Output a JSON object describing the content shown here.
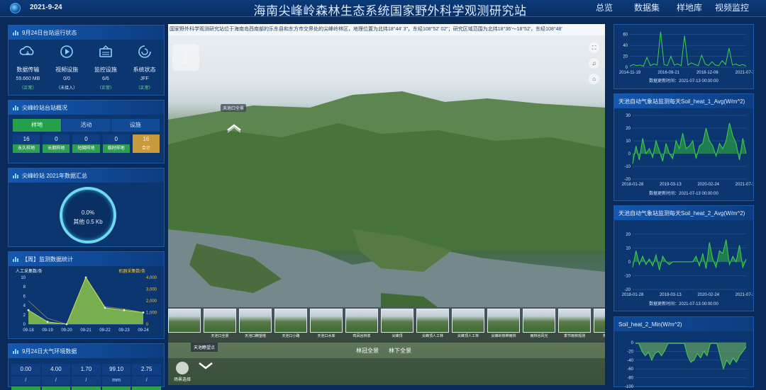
{
  "header": {
    "date": "2021-9-24",
    "title": "海南尖峰岭森林生态系统国家野外科学观测研究站",
    "nav": [
      "总览",
      "数据集",
      "样地库",
      "视频监控"
    ]
  },
  "panel_status": {
    "title": "9月24日台站运行状态",
    "items": [
      {
        "name": "数据传输",
        "value": "59.660 MB",
        "sub": "（正常）",
        "icon": "cloud-icon"
      },
      {
        "name": "视频设施",
        "value": "0/0",
        "sub": "（未接入）",
        "icon": "video-icon"
      },
      {
        "name": "监控设施",
        "value": "6/6",
        "sub": "（正常）",
        "icon": "monitor-icon"
      },
      {
        "name": "系统状态",
        "value": "JFF",
        "sub": "（正常）",
        "icon": "system-icon"
      }
    ]
  },
  "panel_overview": {
    "title": "尖峰岭站台站概况",
    "tabs": [
      "样地",
      "活动",
      "设施"
    ],
    "counts": [
      {
        "num": "16",
        "label": "永久样地"
      },
      {
        "num": "0",
        "label": "长期样地"
      },
      {
        "num": "0",
        "label": "短期样地"
      },
      {
        "num": "0",
        "label": "临时样地"
      },
      {
        "num": "16",
        "label": "合计"
      }
    ]
  },
  "panel_progress": {
    "title": "尖峰岭站 2021年数据汇总",
    "percent": "0.0%",
    "detail": "其他 0.5 Kb"
  },
  "panel_weekly": {
    "title": "【周】监测数据统计",
    "left_label": "人工采集数/条",
    "right_label": "机器采集数/条",
    "chart_data": {
      "type": "area",
      "categories": [
        "09-18",
        "09-19",
        "09-20",
        "09-21",
        "09-22",
        "09-23",
        "09-24"
      ],
      "series": [
        {
          "name": "人工采集数/条",
          "values": [
            3,
            0.5,
            0,
            10,
            3.5,
            3,
            2.5
          ]
        },
        {
          "name": "机器采集数/条",
          "values": [
            2000,
            500,
            0,
            4000,
            1500,
            1300,
            1000
          ]
        }
      ],
      "ylim": [
        0,
        10
      ],
      "y2lim": [
        0,
        4000
      ],
      "yticks": [
        "0",
        "2",
        "4",
        "6",
        "8",
        "10"
      ],
      "y2ticks": [
        "0",
        "1,000",
        "2,000",
        "3,000",
        "4,000"
      ]
    }
  },
  "panel_env": {
    "title": "9月24日大气环境数据",
    "items": [
      {
        "value": "0.00",
        "unit": "/"
      },
      {
        "value": "4.00",
        "unit": "/"
      },
      {
        "value": "1.70",
        "unit": "/"
      },
      {
        "value": "99.10",
        "unit": "mm"
      },
      {
        "value": "2.75",
        "unit": "/"
      }
    ]
  },
  "viewer": {
    "ticker": "国家野外科学观测研究站位于海南岛西南部的乐东县和东方市交界处的尖峰岭林区，地理位置为北纬18°44′ 3″，东经108°52′ 02″；研究区域范围为北纬18°36′～18°52′，东经108°48′",
    "brand": "T",
    "hotspot": "天池口全景",
    "side_buttons": [
      "⛶",
      "♫",
      "⌂"
    ],
    "thumbs": [
      "",
      "天池口全景",
      "天池口瞭望塔",
      "天池口小路",
      "天池口水库",
      "鸣凤谷林浆",
      "尖峰顶",
      "尖峰顶人工林",
      "尖峰顶人工林",
      "尖峰岭热带雨林",
      "雨林谷风光",
      "季节雨林观测",
      "热带雨林"
    ],
    "hover_label": "天池瞭望点",
    "tab_links": [
      "林冠全景",
      "林下全景"
    ],
    "scene_label": "场景选择"
  },
  "right_top": {
    "update": "数据更新时间：2021-07-13 00:00:00",
    "chart_data": {
      "type": "line",
      "xticks": [
        "2014-11-19",
        "2016-09-21",
        "2018-12-06",
        "2021-07-13"
      ],
      "yticks": [
        "0",
        "20",
        "40",
        "60"
      ],
      "ylim": [
        0,
        70
      ],
      "series": [
        {
          "values": [
            2,
            5,
            3,
            4,
            2,
            18,
            3,
            6,
            4,
            65,
            5,
            3,
            20,
            4,
            6,
            3,
            58,
            4,
            8,
            5,
            3,
            22,
            6,
            3,
            10,
            4,
            3,
            12,
            5,
            35,
            4,
            6,
            3,
            5,
            2
          ]
        }
      ]
    }
  },
  "right_mid1": {
    "title": "天池自动气象站监测每天Soil_heat_1_Avg(W/m^2)",
    "update": "数据更新时间：2021-07-13 00:00:00",
    "chart_data": {
      "type": "line",
      "xticks": [
        "2018-01-28",
        "2019-03-13",
        "2020-02-24",
        "2021-07-13"
      ],
      "yticks": [
        "-20",
        "-10",
        "0",
        "10",
        "20",
        "30"
      ],
      "ylim": [
        -20,
        30
      ],
      "series": [
        {
          "values": [
            -8,
            6,
            -5,
            12,
            0,
            4,
            -3,
            10,
            2,
            -6,
            8,
            0,
            -4,
            10,
            4,
            16,
            4,
            6,
            10,
            -4,
            6,
            8,
            20,
            10,
            6,
            -2,
            8,
            4,
            10,
            24,
            14,
            8,
            -5,
            12,
            0
          ]
        }
      ]
    }
  },
  "right_mid2": {
    "title": "天池自动气象站监测每天Soil_heat_2_Avg(W/m^2)",
    "update": "数据更新时间：2021-07-13 00:00:00",
    "chart_data": {
      "type": "line",
      "xticks": [
        "2018-01-28",
        "2019-03-13",
        "2020-02-24",
        "2021-07-13"
      ],
      "yticks": [
        "-20",
        "-10",
        "0",
        "10",
        "20"
      ],
      "ylim": [
        -20,
        25
      ],
      "series": [
        {
          "values": [
            -4,
            8,
            -2,
            4,
            -2,
            2,
            -3,
            5,
            -6,
            4,
            0,
            -2,
            0,
            0,
            0,
            0,
            0,
            0,
            0,
            4,
            -3,
            6,
            -5,
            14,
            2,
            -4,
            8,
            6,
            16,
            -2,
            4,
            0,
            12,
            -4,
            2
          ]
        }
      ]
    }
  },
  "right_bottom": {
    "title": "Soil_heat_2_Min(W/m^2)",
    "chart_data": {
      "type": "line",
      "yticks": [
        "0",
        "-20",
        "-40",
        "-60",
        "-80",
        "-100"
      ],
      "ylim": [
        -100,
        0
      ],
      "series": [
        {
          "values": [
            -2,
            -2,
            -20,
            -30,
            -22,
            -40,
            -25,
            -20,
            -30,
            -18,
            -2,
            -2,
            -2,
            -2,
            -2,
            -2,
            -30,
            -45,
            -40,
            -25,
            -35,
            -20,
            -30,
            -2,
            -2,
            -2,
            -30,
            -60,
            -40,
            -50,
            -35,
            -45,
            -30,
            -20,
            -10
          ]
        }
      ]
    }
  }
}
